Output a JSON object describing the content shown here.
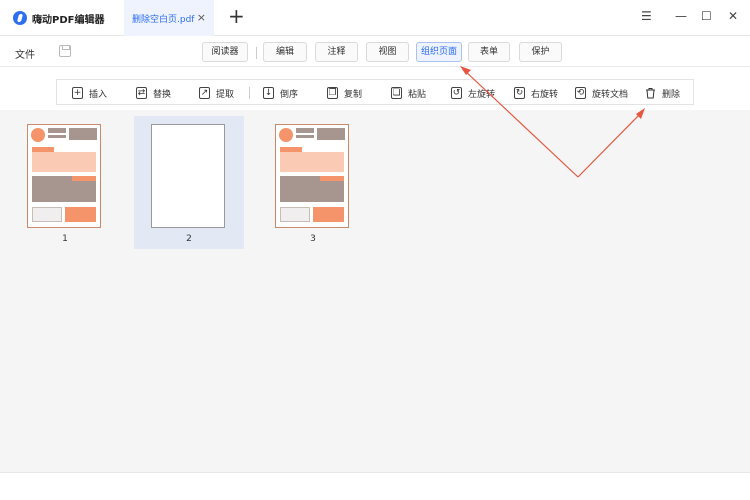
{
  "app": {
    "title": "嗨动PDF编辑器"
  },
  "tab": {
    "label": "删除空白页.pdf",
    "close": "×"
  },
  "new_tab": "+",
  "window": {
    "menu": "☰",
    "minimize": "—",
    "maximize": "☐",
    "close": "✕"
  },
  "menubar": {
    "file": "文件",
    "save_icon": "save-icon",
    "items": [
      "阅读器",
      "编辑",
      "注释",
      "视图",
      "组织页面",
      "表单",
      "保护"
    ],
    "active": "组织页面"
  },
  "toolbar": {
    "tools": [
      {
        "label": "插入",
        "icon": "insert-icon",
        "glyph": "+"
      },
      {
        "label": "替换",
        "icon": "replace-icon",
        "glyph": "⇄"
      },
      {
        "label": "提取",
        "icon": "extract-icon",
        "glyph": "↗"
      },
      {
        "label": "倒序",
        "icon": "reverse-icon",
        "glyph": "↓"
      },
      {
        "label": "复制",
        "icon": "copy-icon",
        "glyph": "❐"
      },
      {
        "label": "粘贴",
        "icon": "paste-icon",
        "glyph": "❏"
      },
      {
        "label": "左旋转",
        "icon": "rotate-left-icon",
        "glyph": "↺"
      },
      {
        "label": "右旋转",
        "icon": "rotate-right-icon",
        "glyph": "↻"
      },
      {
        "label": "旋转文档",
        "icon": "rotate-document-icon",
        "glyph": "⟲"
      },
      {
        "label": "删除",
        "icon": "trash-icon",
        "glyph": "🗑"
      }
    ]
  },
  "pages": [
    {
      "number": "1",
      "blank": false,
      "selected": false
    },
    {
      "number": "2",
      "blank": true,
      "selected": true
    },
    {
      "number": "3",
      "blank": false,
      "selected": false
    }
  ],
  "colors": {
    "accent": "#2d6cf0",
    "annotation_arrow": "#e8563f",
    "thumb_orange": "#f5946a",
    "thumb_light": "#fbcab4",
    "thumb_gray": "#a79690"
  }
}
